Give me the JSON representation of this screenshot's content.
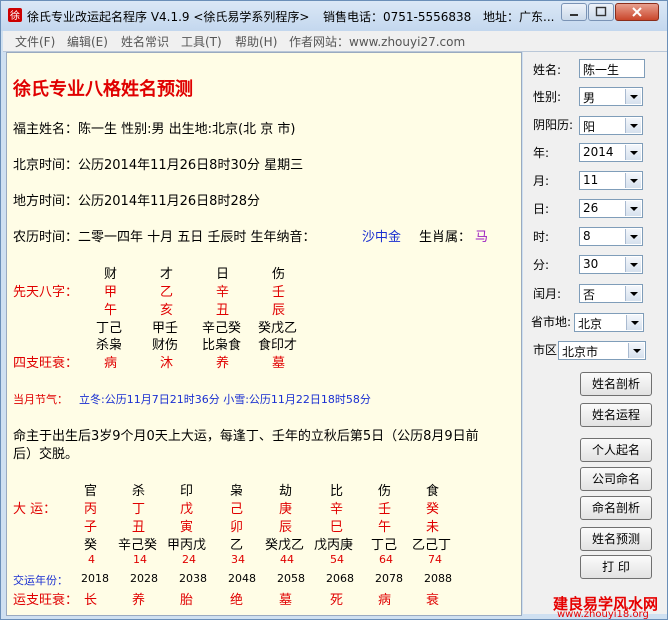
{
  "window": {
    "title": "徐氏专业改运起名程序 V4.1.9 <徐氏易学系列程序>",
    "sales": "销售电话：0751-5556838",
    "address": "地址：广东..."
  },
  "menu": [
    "文件(F)",
    "编辑(E)",
    "姓名常识",
    "工具(T)",
    "帮助(H)",
    "作者网站：www.zhouyi27.com"
  ],
  "report": {
    "title": "徐氏专业八格姓名预测",
    "line1": "福主姓名：陈一生  性别:男   出生地:北京(北 京 市)",
    "line2": "北京时间：公历2014年11月26日8时30分   星期三",
    "line3": "地方时间：公历2014年11月26日8时28分",
    "line4_a": "农历时间：二零一四年 十月 五日 壬辰时     生年纳音：",
    "nayin": "沙中金",
    "zodiac_label": "生肖属：",
    "zodiac": "马",
    "bazi_label": "先天八字：",
    "bazi_top": [
      "财",
      "才",
      "日",
      "伤"
    ],
    "bazi_stem": [
      "甲",
      "乙",
      "辛",
      "壬"
    ],
    "bazi_branch": [
      "午",
      "亥",
      "丑",
      "辰"
    ],
    "bazi_hidden": [
      "丁己",
      "甲壬",
      "辛己癸",
      "癸戊乙"
    ],
    "bazi_gods": [
      "杀枭",
      "财伤",
      "比枭食",
      "食印才"
    ],
    "strength_label": "四支旺衰：",
    "strength": [
      "病",
      "沐",
      "养",
      "墓"
    ],
    "jieqi_label": "当月节气：",
    "jieqi": "立冬:公历11月7日21时36分  小雪:公历11月22日18时58分",
    "yun_line1": "命主于出生后3岁9个月0天上大运，每逢丁、壬年的立秋后第5日（公历8月9日前",
    "yun_line2": "后）交脱。",
    "dayun_label": "大 运：",
    "dayun_top": [
      "官",
      "杀",
      "印",
      "枭",
      "劫",
      "比",
      "伤",
      "食"
    ],
    "dayun_stem": [
      "丙",
      "丁",
      "戊",
      "己",
      "庚",
      "辛",
      "壬",
      "癸"
    ],
    "dayun_branch": [
      "子",
      "丑",
      "寅",
      "卯",
      "辰",
      "巳",
      "午",
      "未"
    ],
    "dayun_hidden": [
      "癸",
      "辛己癸",
      "甲丙戊",
      "乙",
      "癸戊乙",
      "戊丙庚",
      "丁己",
      "乙己丁"
    ],
    "dayun_age": [
      "4",
      "14",
      "24",
      "34",
      "44",
      "54",
      "64",
      "74"
    ],
    "jiaoyun_label": "交运年份：",
    "jiaoyun": [
      "2018",
      "2028",
      "2038",
      "2048",
      "2058",
      "2068",
      "2078",
      "2088"
    ],
    "yunzhi_label": "运支旺衰：",
    "yunzhi": [
      "长",
      "养",
      "胎",
      "绝",
      "墓",
      "死",
      "病",
      "衰"
    ]
  },
  "panel": {
    "name_label": "姓名:",
    "name_value": "陈一生",
    "gender_label": "性别:",
    "gender_value": "男",
    "calendar_label": "阴阳历:",
    "calendar_value": "阳",
    "year_label": "年:",
    "year_value": "2014",
    "month_label": "月:",
    "month_value": "11",
    "day_label": "日:",
    "day_value": "26",
    "hour_label": "时:",
    "hour_value": "8",
    "minute_label": "分:",
    "minute_value": "30",
    "leap_label": "闰月:",
    "leap_value": "否",
    "province_label": "省市地:",
    "province_value": "北京",
    "city_label": "市区:",
    "city_value": "北京市",
    "buttons": [
      "姓名剖析",
      "姓名运程",
      "个人起名",
      "公司命名",
      "命名剖析",
      "姓名预测",
      "打 印"
    ]
  },
  "watermark": {
    "line1": "建良易学风水网",
    "line2": "www.zhouyi18.org"
  }
}
